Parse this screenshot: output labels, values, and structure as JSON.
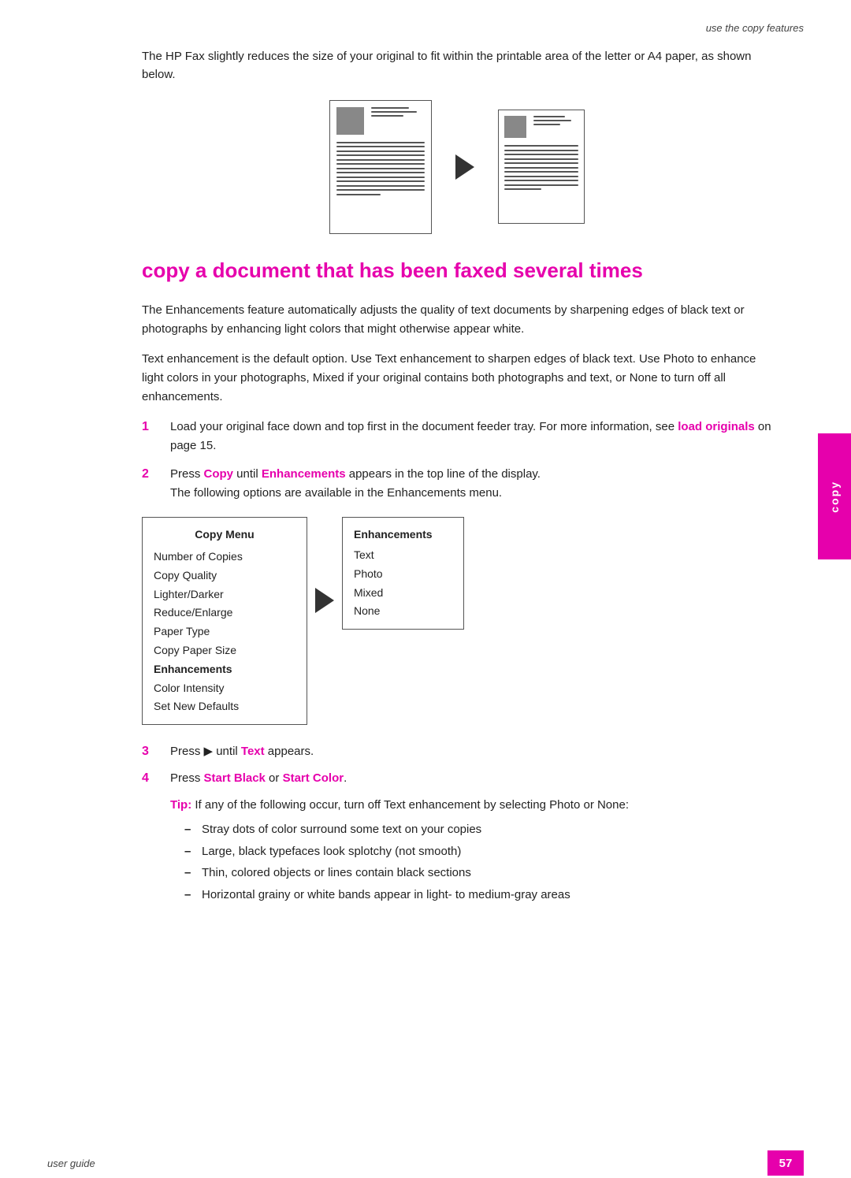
{
  "header": {
    "top_right": "use the copy features"
  },
  "intro": {
    "paragraph": "The HP Fax slightly reduces the size of your original to fit within the printable area of the letter or A4 paper, as shown below."
  },
  "section": {
    "heading": "copy a document that has been faxed several times",
    "para1": "The Enhancements feature automatically adjusts the quality of text documents by sharpening edges of black text or photographs by enhancing light colors that might otherwise appear white.",
    "para2": "Text enhancement is the default option. Use Text enhancement to sharpen edges of black text. Use Photo to enhance light colors in your photographs, Mixed if your original contains both photographs and text, or None to turn off all enhancements."
  },
  "steps": [
    {
      "num": "1",
      "text": "Load your original face down and top first in the document feeder tray. For more information, see ",
      "link_text": "load originals",
      "text2": " on page 15."
    },
    {
      "num": "2",
      "text": "Press ",
      "copy_label": "Copy",
      "text2": " until ",
      "enhancements_label": "Enhancements",
      "text3": " appears in the top line of the display.",
      "subtext": "The following options are available in the Enhancements menu."
    }
  ],
  "copy_menu": {
    "title": "Copy Menu",
    "items": [
      "Number of Copies",
      "Copy Quality",
      "Lighter/Darker",
      "Reduce/Enlarge",
      "Paper Type",
      "Copy Paper Size",
      "Enhancements",
      "Color Intensity",
      "Set New Defaults"
    ],
    "bold_item": "Enhancements"
  },
  "enhancements_menu": {
    "title": "Enhancements",
    "items": [
      "Text",
      "Photo",
      "Mixed",
      "None"
    ]
  },
  "step3": {
    "num": "3",
    "text": "Press ▶ until ",
    "text_label": "Text",
    "text2": " appears."
  },
  "step4": {
    "num": "4",
    "text": "Press ",
    "start_black": "Start Black",
    "text2": " or ",
    "start_color": "Start Color",
    "text3": "."
  },
  "tip": {
    "label": "Tip:",
    "text": "  If any of the following occur, turn off Text enhancement by selecting Photo or None:"
  },
  "bullet_items": [
    "Stray dots of color surround some text on your copies",
    "Large, black typefaces look splotchy (not smooth)",
    "Thin, colored objects or lines contain black sections",
    "Horizontal grainy or white bands appear in light- to medium-gray areas"
  ],
  "right_tab": {
    "label": "copy"
  },
  "footer": {
    "left": "user guide",
    "page": "57"
  }
}
